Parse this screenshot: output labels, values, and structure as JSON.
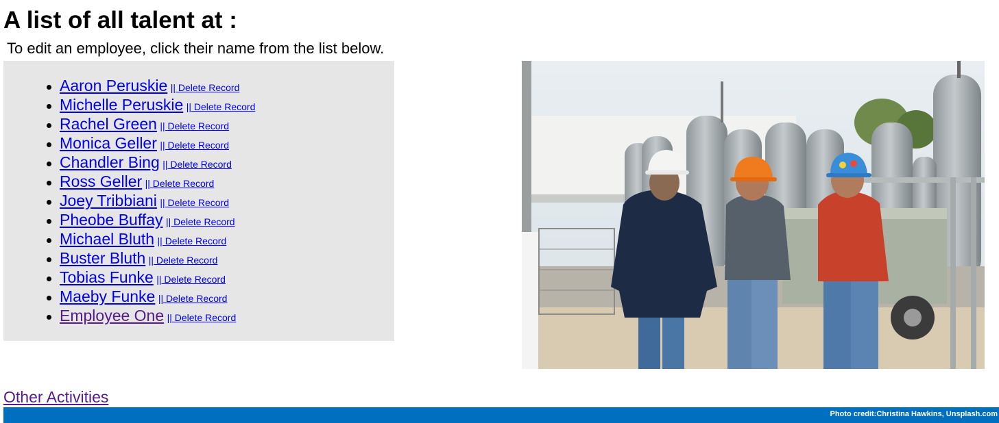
{
  "header": {
    "title": "A list of all talent at :",
    "instructions": "To edit an employee, click their name from the list below."
  },
  "employees": [
    {
      "name": "Aaron Peruskie",
      "delete_label": "|| Delete Record",
      "visited": false
    },
    {
      "name": "Michelle Peruskie",
      "delete_label": "|| Delete Record",
      "visited": false
    },
    {
      "name": "Rachel Green",
      "delete_label": "|| Delete Record",
      "visited": false
    },
    {
      "name": "Monica Geller",
      "delete_label": "|| Delete Record",
      "visited": false
    },
    {
      "name": "Chandler Bing",
      "delete_label": "|| Delete Record",
      "visited": false
    },
    {
      "name": "Ross Geller",
      "delete_label": "|| Delete Record",
      "visited": false
    },
    {
      "name": "Joey Tribbiani",
      "delete_label": "|| Delete Record",
      "visited": false
    },
    {
      "name": "Pheobe Buffay",
      "delete_label": "|| Delete Record",
      "visited": false
    },
    {
      "name": "Michael Bluth",
      "delete_label": "|| Delete Record",
      "visited": false
    },
    {
      "name": "Buster Bluth",
      "delete_label": "|| Delete Record",
      "visited": false
    },
    {
      "name": "Tobias Funke",
      "delete_label": "|| Delete Record",
      "visited": false
    },
    {
      "name": "Maeby Funke",
      "delete_label": "|| Delete Record",
      "visited": false
    },
    {
      "name": "Employee One",
      "delete_label": "|| Delete Record",
      "visited": true
    }
  ],
  "photo": {
    "icon": "construction-workers-photo"
  },
  "nav": {
    "other_activities": "Other Activities"
  },
  "footer": {
    "credit": "Photo credit:Christina Hawkins, Unsplash.com"
  },
  "colors": {
    "link": "#0000ee",
    "visited_link": "#551a8b",
    "list_background": "#e6e6e6",
    "footer_background": "#006fbf"
  }
}
